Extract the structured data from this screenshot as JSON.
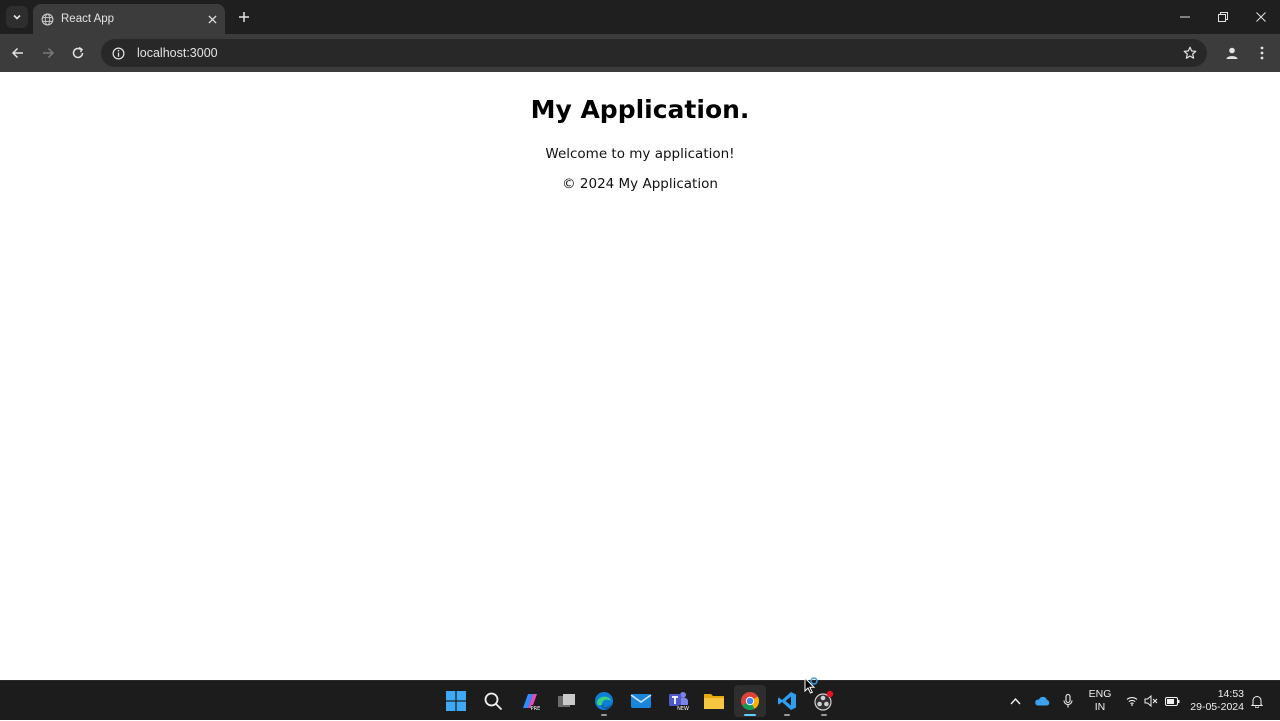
{
  "browser": {
    "tab_title": "React App",
    "url": "localhost:3000"
  },
  "page": {
    "heading": "My Application.",
    "welcome": "Welcome to my application!",
    "footer": "© 2024 My Application"
  },
  "taskbar": {
    "apps": [
      "start-icon",
      "search-icon",
      "copilot-icon",
      "task-view-icon",
      "edge-icon",
      "mail-icon",
      "teams-icon",
      "file-explorer-icon",
      "chrome-icon",
      "vscode-icon",
      "obs-icon"
    ],
    "language_line1": "ENG",
    "language_line2": "IN",
    "time": "14:53",
    "date": "29-05-2024"
  },
  "colors": {
    "titlebar": "#1f1f1f",
    "toolbar": "#3c3c3c",
    "taskbar": "#1c1c1c",
    "accent": "#60cdff"
  }
}
